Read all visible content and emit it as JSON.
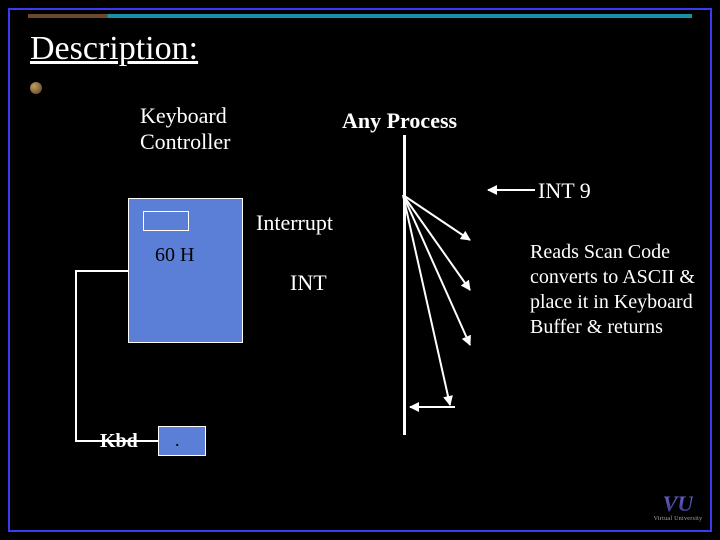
{
  "title": "Description:",
  "labels": {
    "kbd_controller_l1": "Keyboard",
    "kbd_controller_l2": "Controller",
    "any_process": "Any Process",
    "int9": "INT 9",
    "interrupt": "Interrupt",
    "int": "INT",
    "port": "60 H",
    "kbd": "Kbd",
    "kbd_dot": ".",
    "reads_scan": "Reads Scan Code converts to ASCII & place it in Keyboard Buffer & returns"
  },
  "logo": {
    "vu": "VU",
    "sub": "Virtual University"
  }
}
